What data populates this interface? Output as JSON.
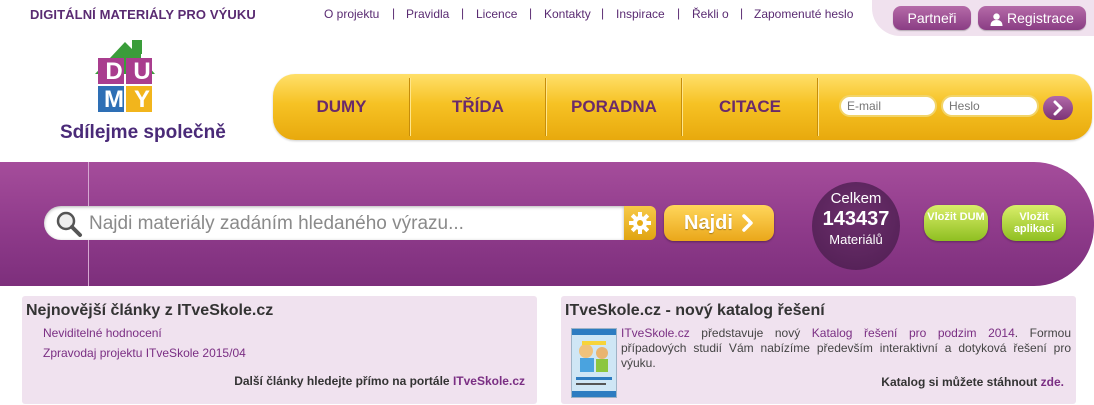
{
  "topbar": {
    "tagline": "DIGITÁLNÍ MATERIÁLY PRO VÝUKU",
    "links": [
      "O projektu",
      "Pravidla",
      "Licence",
      "Kontakty",
      "Inspirace",
      "Řekli o",
      "Zapomenuté heslo"
    ],
    "partneri": "Partneři",
    "registrace": "Registrace"
  },
  "logo": {
    "letters": [
      "D",
      "U",
      "M",
      "Y"
    ],
    "slogan": "Sdílejme společně"
  },
  "nav": {
    "items": [
      "DUMY",
      "TŘÍDA",
      "PORADNA",
      "CITACE"
    ],
    "email_placeholder": "E-mail",
    "password_placeholder": "Heslo"
  },
  "search": {
    "placeholder": "Najdi materiály zadáním hledaného výrazu...",
    "button": "Najdi"
  },
  "counter": {
    "label_top": "Celkem",
    "value": "143437",
    "label_bottom": "Materiálů"
  },
  "actions": {
    "upload_dum": "Vložit DUM",
    "upload_app": "Vložit aplikaci"
  },
  "left_panel": {
    "title": "Nejnovější články z ITveSkole.cz",
    "articles": [
      "Neviditelné hodnocení",
      "Zpravodaj projektu ITveSkole 2015/04"
    ],
    "footer_text": "Další články hledejte přímo na portále",
    "footer_link": "ITveSkole.cz"
  },
  "right_panel": {
    "title": "ITveSkole.cz - nový katalog řešení",
    "link1": "ITveSkole.cz",
    "text1": "představuje nový",
    "link2": "Katalog řešení pro podzim 2014",
    "text2": ". Formou případových studií Vám nabízíme především interaktivní a dotyková řešení pro výuku.",
    "footer_text": "Katalog si můžete stáhnout",
    "footer_link": "zde."
  },
  "colors": {
    "brand_purple": "#8e3a8a",
    "nav_yellow": "#f6c224",
    "action_green": "#9cc82c"
  }
}
